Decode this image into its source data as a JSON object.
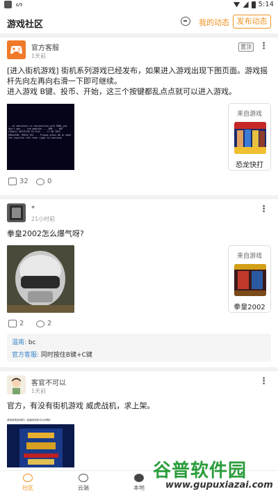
{
  "status_bar": {
    "time": "5:14"
  },
  "header": {
    "title": "游戏社区",
    "my_activity": "我的动态",
    "post_button": "发布动态"
  },
  "posts": [
    {
      "author": "官方客服",
      "badge": "置顶",
      "time": "1天前",
      "content": "[进入街机游戏] 街机系列游戏已经发布，如果进入游戏出现下图页面。游戏摇杆先向左再向右滑一下即可继续。\n进入游戏 B键、投币、开始，这三个按键都乱点点就可以进入游戏。",
      "image_text": "...of emulators in conjunction with ROMs you don't own ... the machine ... ROM ... NOT LEGALLY ENTITLED TO PLAY ... 17 ON THIS EMULATOR, PRESS ESC ... Please press OK or move the joystick left then right to continue",
      "game_card": {
        "from_label": "来自游戏",
        "game_name": "恐龙快打"
      },
      "likes": "32",
      "comments": "0"
    },
    {
      "author": "*",
      "time": "21小时前",
      "content": "拳皇2002怎么爆气呀?",
      "game_card": {
        "from_label": "来自游戏",
        "game_name": "拳皇2002"
      },
      "likes": "2",
      "comments": "2",
      "replies": [
        {
          "who": "温南:",
          "text": " bc"
        },
        {
          "who": "官方客服:",
          "text": " 同时按住B键+C键"
        }
      ]
    },
    {
      "author": "客官不可以",
      "time": "1天前",
      "content": "官方，有没有街机游戏 威虎战机，求上架。",
      "image_caption": "请机械场战戏机?--如威虎战机可以吗啊d"
    }
  ],
  "bottom_nav": [
    {
      "label": "社区",
      "icon": "community-icon",
      "active": true
    },
    {
      "label": "云端",
      "icon": "cloud-icon",
      "active": false
    },
    {
      "label": "本地",
      "icon": "local-icon",
      "active": false
    }
  ],
  "watermark": {
    "main": "谷普软件园",
    "url": "www.gupuxiazai.com"
  },
  "colors": {
    "accent": "#f0931f",
    "link": "#3b86c8",
    "watermark": "#2a9d3b"
  }
}
